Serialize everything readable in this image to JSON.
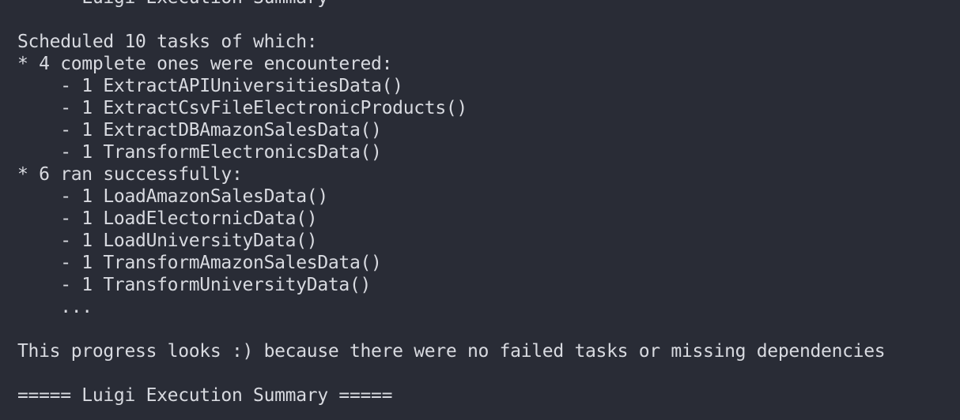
{
  "terminal": {
    "lines": [
      "===== Luigi Execution Summary =====",
      "",
      "Scheduled 10 tasks of which:",
      "* 4 complete ones were encountered:",
      "    - 1 ExtractAPIUniversitiesData()",
      "    - 1 ExtractCsvFileElectronicProducts()",
      "    - 1 ExtractDBAmazonSalesData()",
      "    - 1 TransformElectronicsData()",
      "* 6 ran successfully:",
      "    - 1 LoadAmazonSalesData()",
      "    - 1 LoadElectornicData()",
      "    - 1 LoadUniversityData()",
      "    - 1 TransformAmazonSalesData()",
      "    - 1 TransformUniversityData()",
      "    ...",
      "",
      "This progress looks :) because there were no failed tasks or missing dependencies",
      "",
      "===== Luigi Execution Summary ====="
    ]
  }
}
